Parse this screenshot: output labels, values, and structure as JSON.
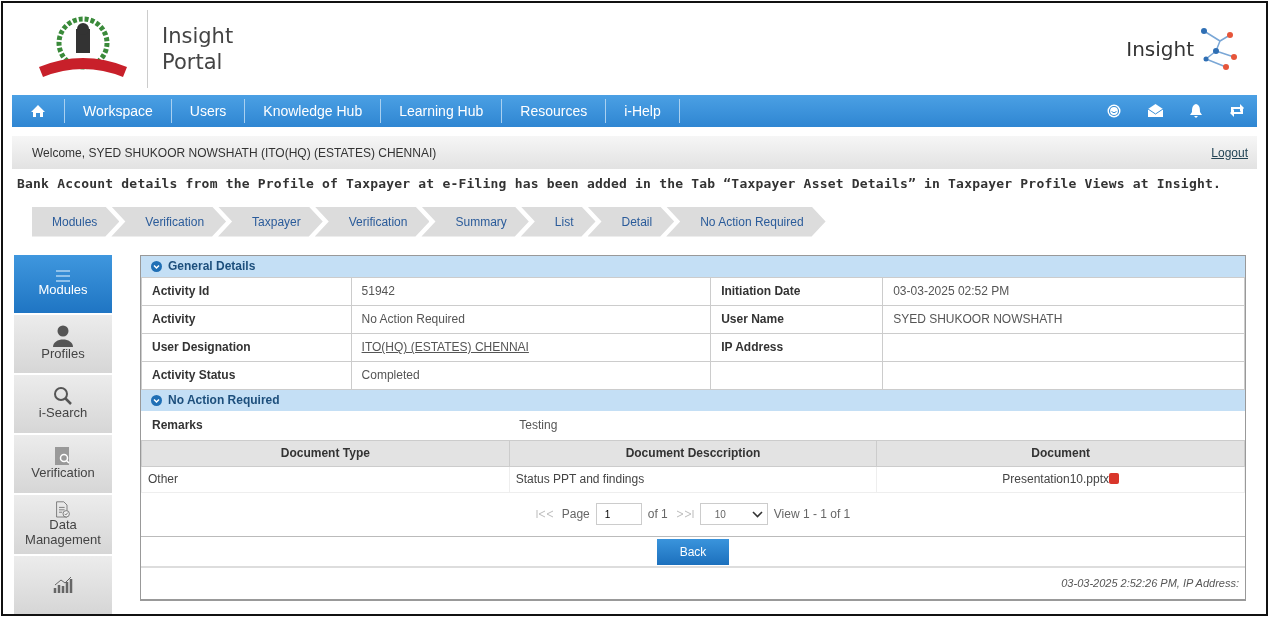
{
  "header": {
    "title_line1": "Insight",
    "title_line2": "Portal",
    "brand": "Insight"
  },
  "nav": {
    "items": [
      "Workspace",
      "Users",
      "Knowledge Hub",
      "Learning Hub",
      "Resources",
      "i-Help"
    ]
  },
  "welcome": "Welcome, SYED SHUKOOR NOWSHATH (ITO(HQ) (ESTATES) CHENNAI)",
  "logout": "Logout",
  "announcement": "Bank Account details from the Profile of Taxpayer at e-Filing has been added in the Tab “Taxpayer Asset Details” in Taxpayer Profile Views at Insight.",
  "breadcrumb": [
    "Modules",
    "Verification",
    "Taxpayer",
    "Verification",
    "Summary",
    "List",
    "Detail",
    "No Action Required"
  ],
  "sidebar": {
    "items": [
      {
        "label": "Modules",
        "selected": true
      },
      {
        "label": "Profiles",
        "selected": false
      },
      {
        "label": "i-Search",
        "selected": false
      },
      {
        "label": "Verification",
        "selected": false
      },
      {
        "label": "Data Management",
        "selected": false
      },
      {
        "selected": false
      }
    ]
  },
  "general_details": {
    "title": "General Details",
    "rows": [
      {
        "label": "Activity Id",
        "value": "51942",
        "label2": "Initiation Date",
        "value2": "03-03-2025 02:52 PM"
      },
      {
        "label": "Activity",
        "value": "No Action Required",
        "label2": "User Name",
        "value2": "SYED SHUKOOR NOWSHATH"
      },
      {
        "label": "User Designation",
        "value": "ITO(HQ) (ESTATES) CHENNAI",
        "link": true,
        "label2": "IP Address"
      },
      {
        "label": "Activity Status",
        "value": "Completed"
      }
    ]
  },
  "no_action": {
    "title": "No Action Required",
    "remarks_label": "Remarks",
    "remarks": "Testing",
    "columns": [
      "Document Type",
      "Document Desccription",
      "Document"
    ],
    "rows": [
      [
        "Other",
        "Status PPT and findings",
        "Presentation10.pptx"
      ]
    ]
  },
  "pager": {
    "page_label": "Page",
    "page": "1",
    "of": "of 1",
    "page_size": "10",
    "view": "View 1 - 1 of 1"
  },
  "back": "Back",
  "footer": "03-03-2025 2:52:26 PM, IP Address:"
}
